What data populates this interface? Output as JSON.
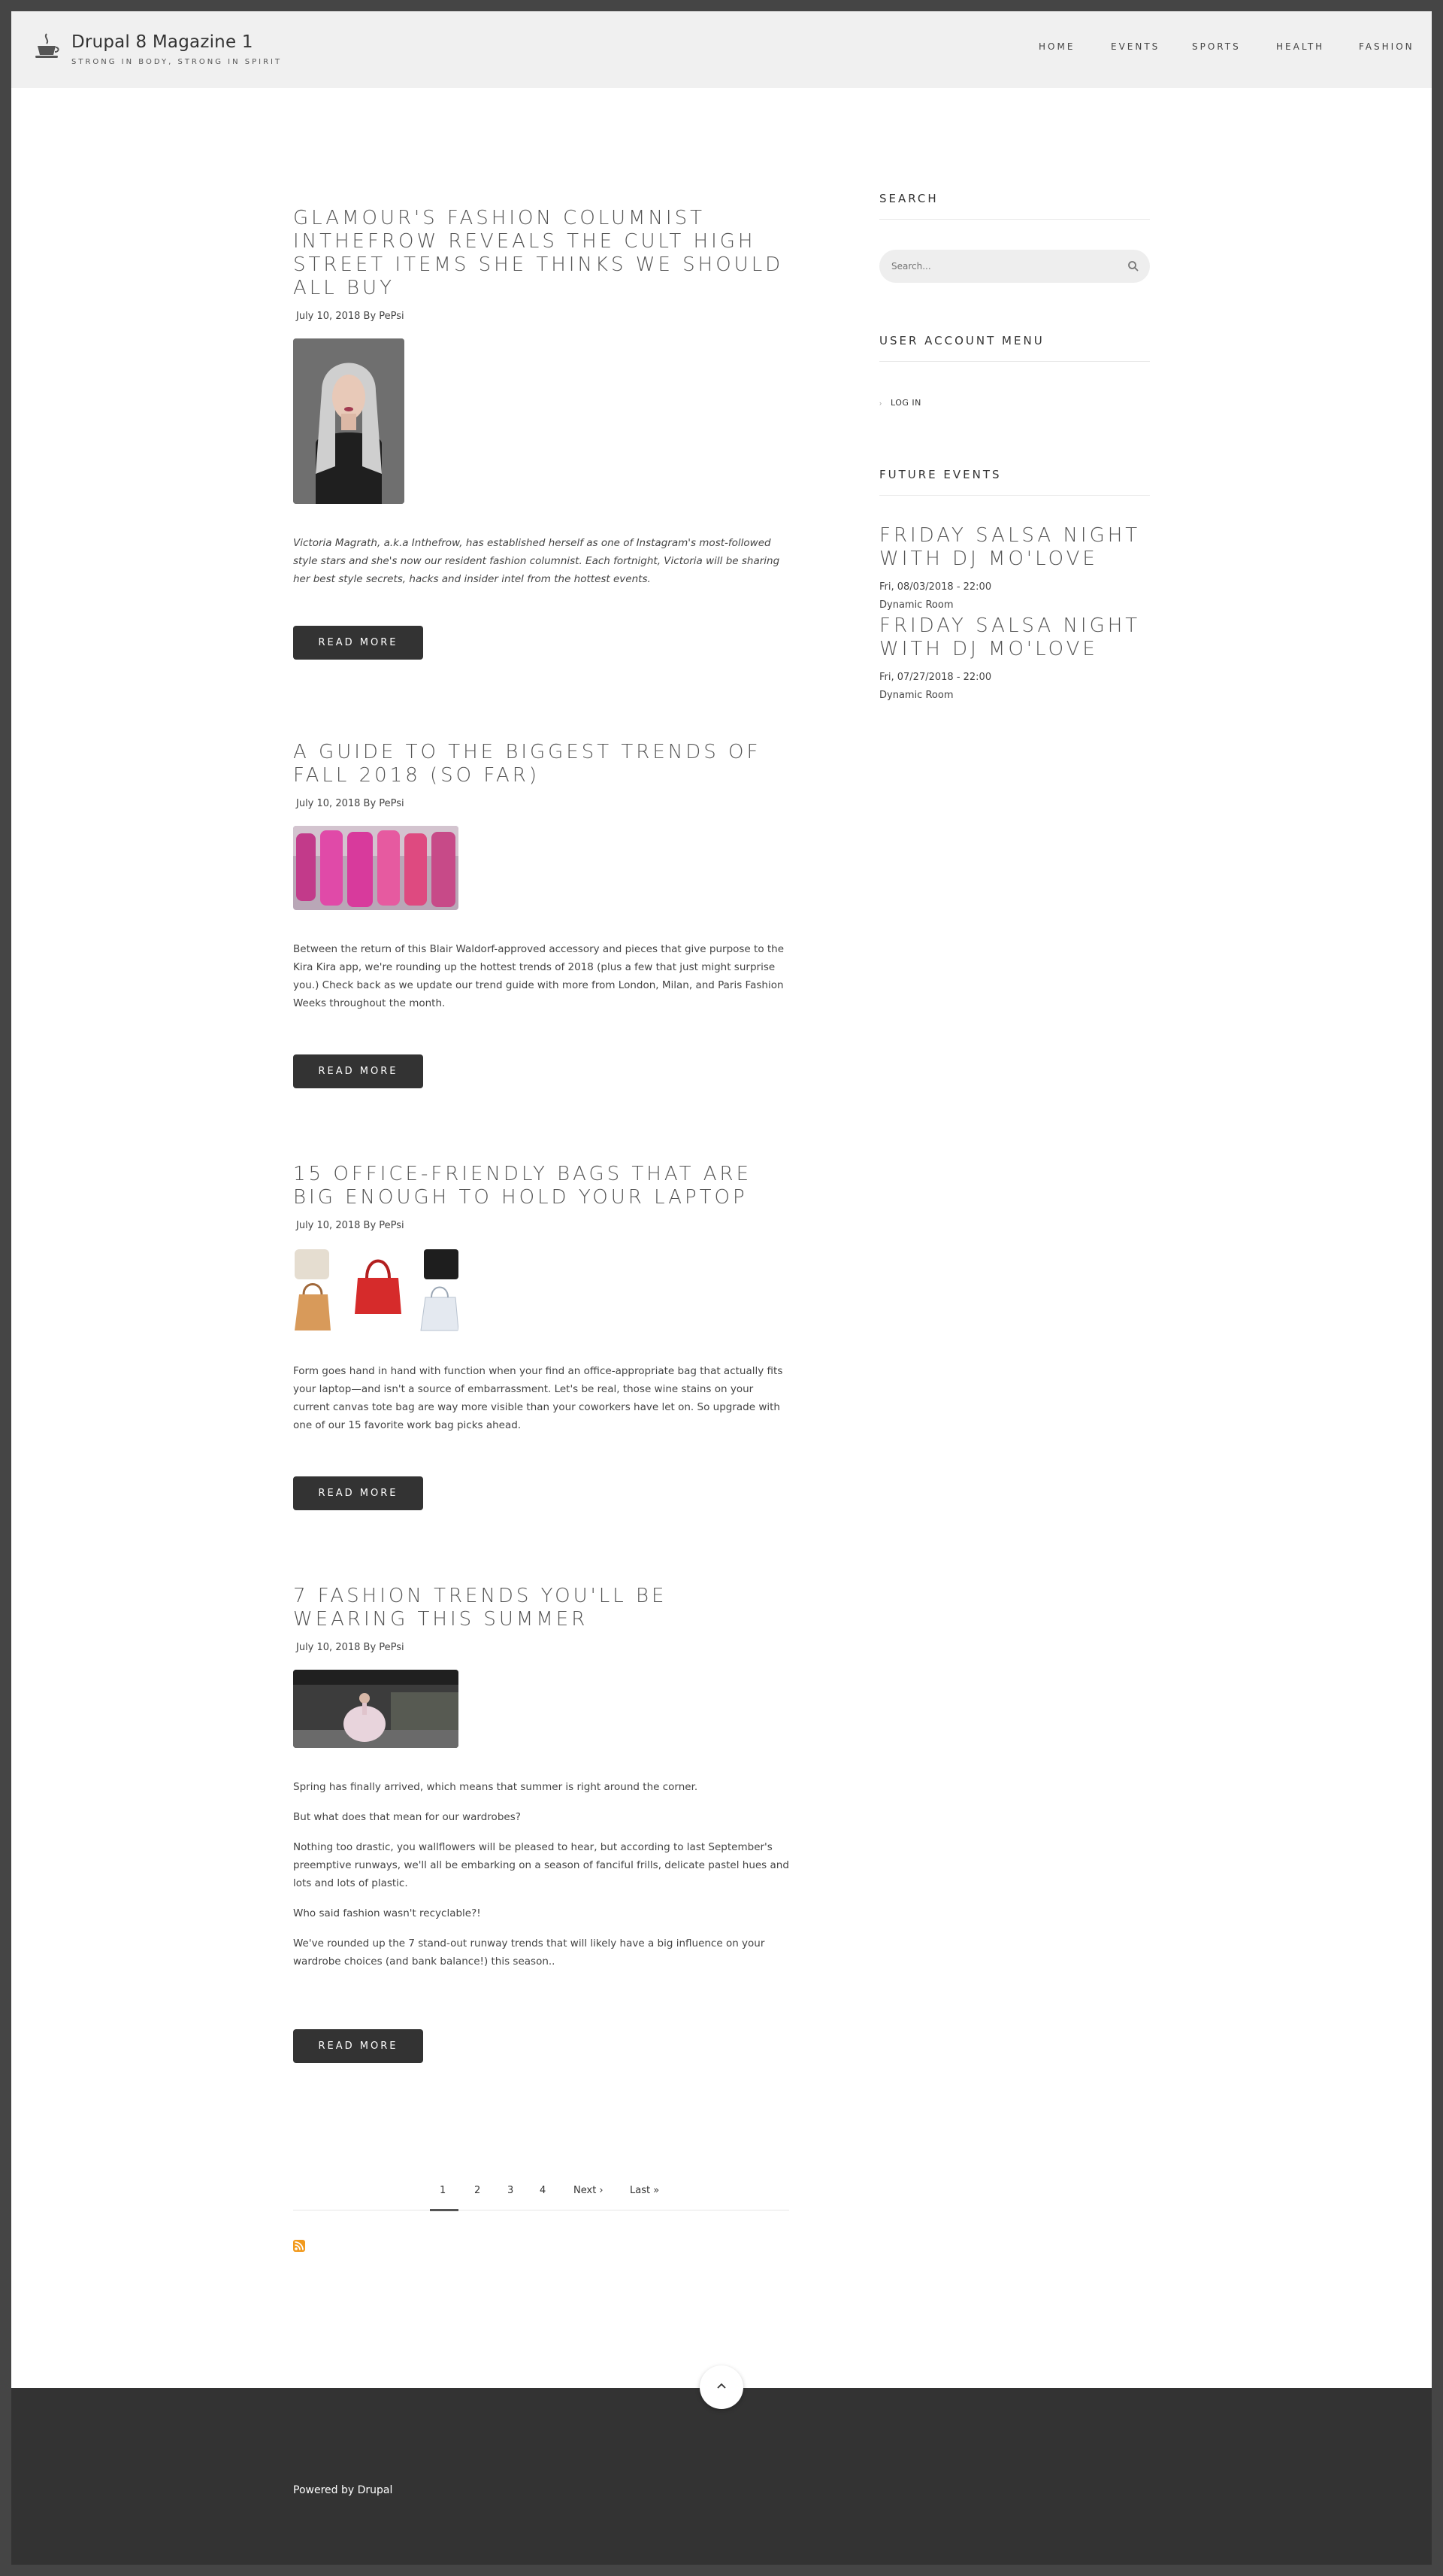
{
  "header": {
    "site_name": "Drupal 8 Magazine 1",
    "slogan": "STRONG IN BODY, STRONG IN SPIRIT",
    "nav": [
      "HOME",
      "EVENTS",
      "SPORTS",
      "HEALTH",
      "FASHION"
    ]
  },
  "posts": [
    {
      "title": "GLAMOUR'S FASHION COLUMNIST INTHEFROW REVEALS THE CULT HIGH STREET ITEMS SHE THINKS WE SHOULD ALL BUY",
      "meta": "July 10, 2018 By PePsi",
      "body": [
        "Victoria Magrath, a.k.a Inthefrow, has established herself as one of Instagram's most-followed style stars and she's now our resident fashion columnist. Each fortnight, Victoria will be sharing her best style secrets, hacks and insider intel from the hottest events."
      ],
      "read_more": "READ MORE"
    },
    {
      "title": "A GUIDE TO THE BIGGEST TRENDS OF FALL 2018 (SO FAR)",
      "meta": "July 10, 2018 By PePsi",
      "body": [
        "Between the return of this Blair Waldorf-approved accessory and pieces that give purpose to the Kira Kira app, we're rounding up the hottest trends of 2018 (plus a few that just might surprise you.) Check back as we update our trend guide with more from London, Milan, and Paris Fashion Weeks throughout the month."
      ],
      "read_more": "READ MORE"
    },
    {
      "title": "15 OFFICE-FRIENDLY BAGS THAT ARE BIG ENOUGH TO HOLD YOUR LAPTOP",
      "meta": "July 10, 2018 By PePsi",
      "body": [
        "Form goes hand in hand with function when your find an office-appropriate bag that actually fits your laptop—and isn't a source of embarrassment. Let's be real, those wine stains on your current canvas tote bag are way more visible than your coworkers have let on. So upgrade with one of our 15 favorite work bag picks ahead."
      ],
      "read_more": "READ MORE"
    },
    {
      "title": "7 FASHION TRENDS YOU'LL BE WEARING THIS SUMMER",
      "meta": "July 10, 2018 By PePsi",
      "body": [
        "Spring has finally arrived, which means that summer is right around the corner.",
        "But what does that mean for our wardrobes?",
        "Nothing too drastic, you wallflowers will be pleased to hear, but according to last September's preemptive runways, we'll all be embarking on a season of fanciful frills, delicate pastel hues and lots and lots of plastic.",
        "Who said fashion wasn't recyclable?!",
        "We've rounded up the 7 stand-out runway trends that will likely have a big influence on your wardrobe choices (and bank balance!) this season.."
      ],
      "read_more": "READ MORE"
    }
  ],
  "pager": {
    "items": [
      "1",
      "2",
      "3",
      "4",
      "Next ›",
      "Last »"
    ]
  },
  "sidebar": {
    "search": {
      "title": "SEARCH",
      "placeholder": "Search..."
    },
    "account": {
      "title": "USER ACCOUNT MENU",
      "items": [
        "LOG IN"
      ]
    },
    "events": {
      "title": "FUTURE EVENTS",
      "items": [
        {
          "title": "FRIDAY SALSA NIGHT WITH DJ MO'LOVE",
          "date": "Fri, 08/03/2018 - 22:00",
          "location": "Dynamic Room"
        },
        {
          "title": "FRIDAY SALSA NIGHT WITH DJ MO'LOVE",
          "date": "Fri, 07/27/2018 - 22:00",
          "location": "Dynamic Room"
        }
      ]
    }
  },
  "footer": {
    "text": "Powered by Drupal"
  },
  "colors": {
    "footer": "#333333",
    "button": "#333333",
    "header": "#f0f0f0",
    "rss": "#f29a1d"
  }
}
